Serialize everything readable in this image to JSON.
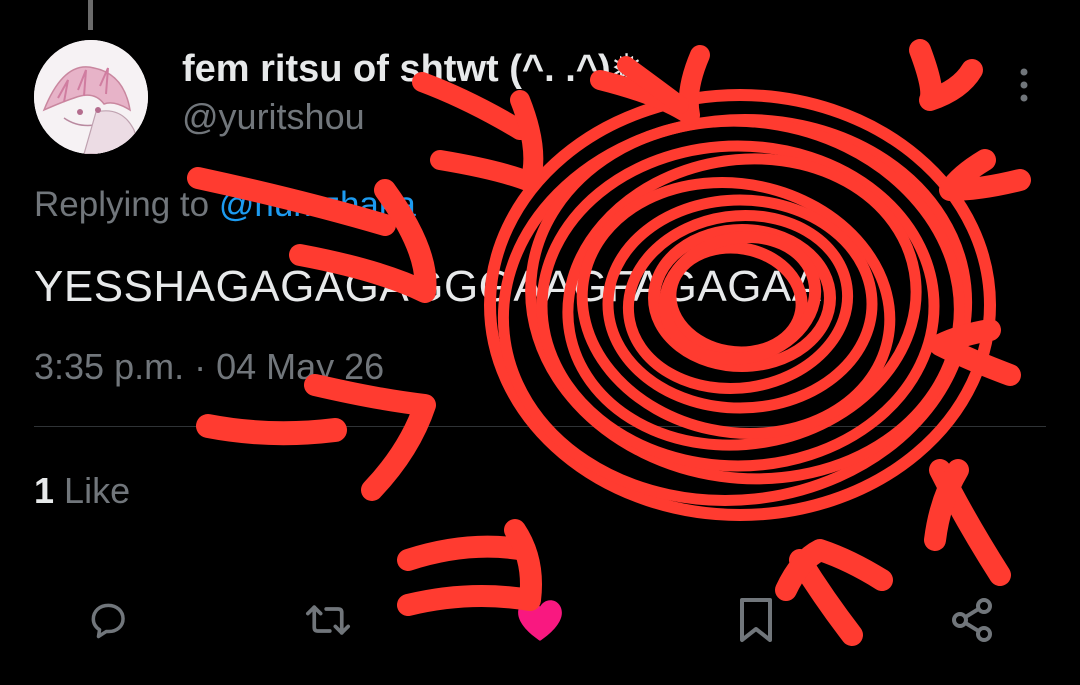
{
  "tweet": {
    "display_name": "fem ritsu of shtwt (^. .^)❅",
    "handle": "@yuritshou",
    "reply_prefix": "Replying to ",
    "reply_mention": "@numzhaka",
    "text": "YESSHAGAGAGAGGGAAGFAGAGAA",
    "timestamp": "3:35 p.m. · 04 May 26",
    "like_count": "1",
    "like_label": "Like"
  },
  "icons": {
    "more": "more-vertical-icon",
    "reply": "reply-bubble-icon",
    "retweet": "retweet-icon",
    "like": "heart-icon",
    "bookmark": "bookmark-icon",
    "share": "share-icon"
  },
  "colors": {
    "background": "#000000",
    "text_primary": "#e7e9ea",
    "text_secondary": "#71767b",
    "link": "#1d9bf0",
    "like_active": "#f91880",
    "scribble": "#ff3b30"
  }
}
